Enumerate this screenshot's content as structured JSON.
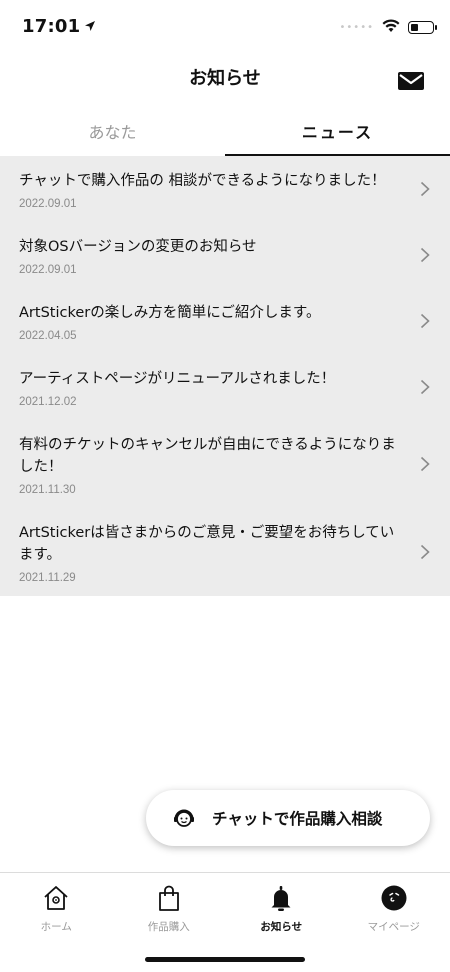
{
  "status_bar": {
    "time": "17:01",
    "icons": [
      "location-arrow-icon",
      "signal-dots-icon",
      "wifi-icon",
      "battery-icon"
    ],
    "battery_level": 0.4
  },
  "header": {
    "title": "お知らせ",
    "mail_icon": "envelope-icon"
  },
  "tabs": [
    {
      "label": "あなた",
      "active": false
    },
    {
      "label": "ニュース",
      "active": true
    }
  ],
  "news": [
    {
      "title": "チャットで購入作品の 相談ができるようになりました！",
      "date": "2022.09.01"
    },
    {
      "title": "対象OSバージョンの変更のお知らせ",
      "date": "2022.09.01"
    },
    {
      "title": "ArtStickerの楽しみ方を簡単にご紹介します。",
      "date": "2022.04.05"
    },
    {
      "title": "アーティストページがリニューアルされました！",
      "date": "2021.12.02"
    },
    {
      "title": "有料のチケットのキャンセルが自由にできるようになりました！",
      "date": "2021.11.30"
    },
    {
      "title": "ArtStickerは皆さまからのご意見・ご要望をお待ちしています。",
      "date": "2021.11.29"
    }
  ],
  "chat_button": {
    "label": "チャットで作品購入相談",
    "icon": "support-agent-icon"
  },
  "bottom_nav": [
    {
      "label": "ホーム",
      "icon": "home-icon",
      "active": false
    },
    {
      "label": "作品購入",
      "icon": "shopping-bag-icon",
      "active": false
    },
    {
      "label": "お知らせ",
      "icon": "bell-icon",
      "active": true
    },
    {
      "label": "マイページ",
      "icon": "profile-face-icon",
      "active": false
    }
  ],
  "colors": {
    "accent": "#111111",
    "list_background": "#ececec",
    "inactive_text": "#9a9a9a",
    "date_text": "#8a8a8a"
  }
}
